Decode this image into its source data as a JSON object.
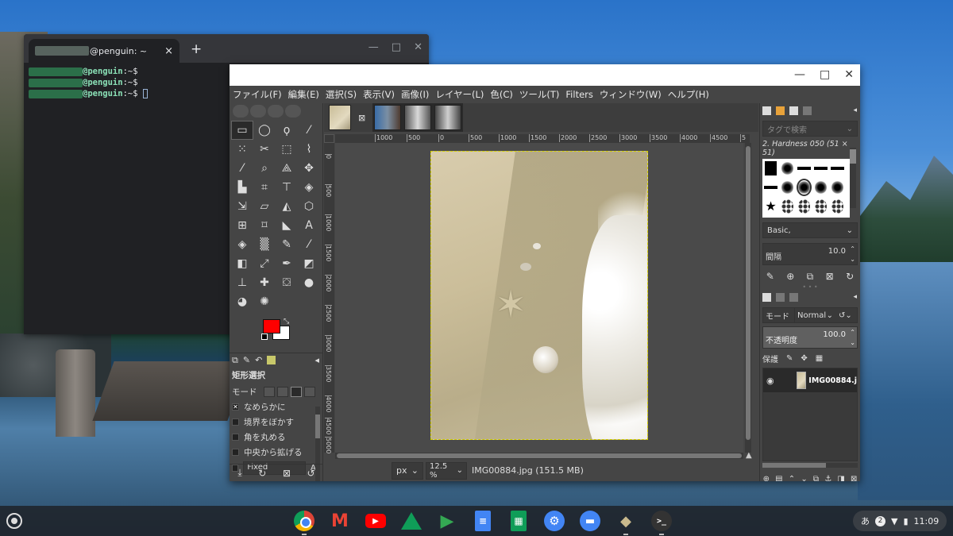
{
  "terminal": {
    "tab_title": "@penguin: ~",
    "close": "×",
    "new_tab": "+",
    "win_min": "—",
    "win_max": "□",
    "win_close": "✕",
    "lines": [
      {
        "host": "@penguin",
        "path": ":~$"
      },
      {
        "host": "@penguin",
        "path": ":~$"
      },
      {
        "host": "@penguin",
        "path": ":~$"
      }
    ]
  },
  "gimp": {
    "win_min": "—",
    "win_max": "□",
    "win_close": "✕",
    "menu": [
      "ファイル(F)",
      "編集(E)",
      "選択(S)",
      "表示(V)",
      "画像(I)",
      "レイヤー(L)",
      "色(C)",
      "ツール(T)",
      "Filters",
      "ウィンドウ(W)",
      "ヘルプ(H)"
    ],
    "tool_options": {
      "title": "矩形選択",
      "mode_label": "モード",
      "antialias": "なめらかに",
      "feather": "境界をぼかす",
      "rounded": "角を丸める",
      "expand_center": "中央から拡げる",
      "fixed": "Fixed",
      "fixed_extra": "As"
    },
    "rulers": {
      "h": [
        "1000",
        "500",
        "0",
        "500",
        "1000",
        "1500",
        "2000",
        "2500",
        "3000",
        "3500",
        "4000",
        "4500",
        "5"
      ],
      "v": [
        "0",
        "500",
        "1000",
        "1500",
        "2000",
        "2500",
        "3000",
        "3500",
        "4000",
        "4500",
        "5000"
      ]
    },
    "status": {
      "unit": "px",
      "zoom": "12.5 %",
      "file": "IMG00884.jpg (151.5 MB)"
    },
    "brushes": {
      "tag_placeholder": "タグで検索",
      "brush_name": "2. Hardness 050 (51 × 51)",
      "preset": "Basic,",
      "spacing_label": "間隔",
      "spacing_value": "10.0"
    },
    "layers": {
      "mode_label": "モード",
      "mode_value": "Normal",
      "opacity_label": "不透明度",
      "opacity_value": "100.0",
      "lock_label": "保護",
      "layer_name": "IMG00884.j"
    }
  },
  "shelf": {
    "apps": [
      "Chrome",
      "Gmail",
      "YouTube",
      "Drive",
      "Play Store",
      "Docs",
      "Sheets",
      "Settings",
      "Files",
      "GIMP",
      "Terminal"
    ],
    "ime": "あ",
    "notifications": "2",
    "time": "11:09"
  }
}
